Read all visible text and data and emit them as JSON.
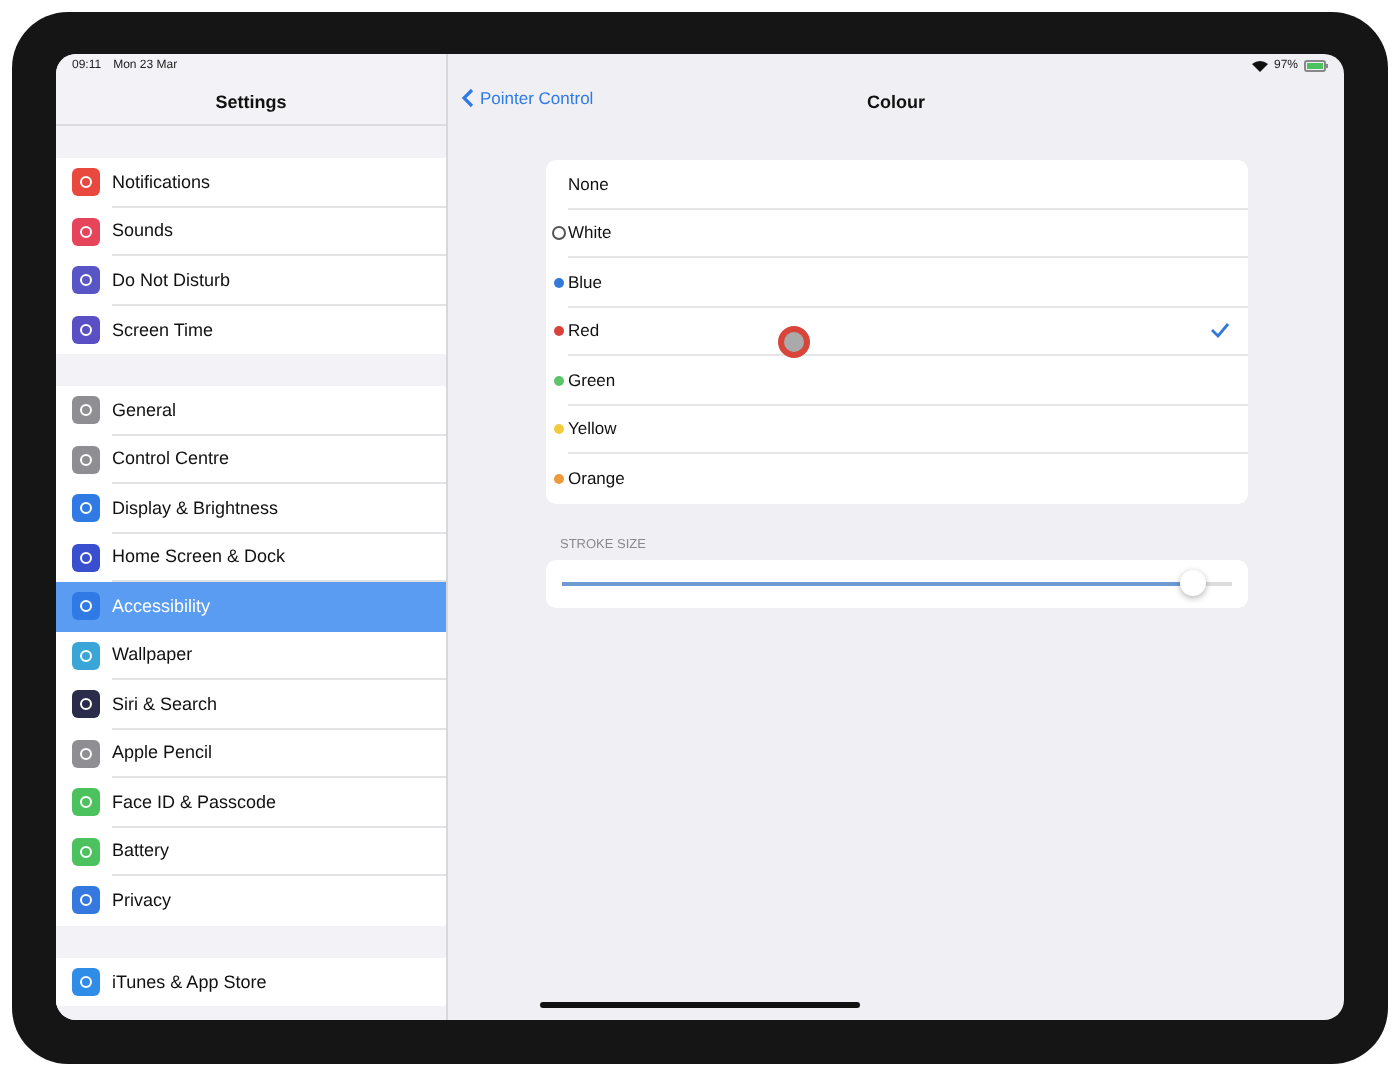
{
  "status_bar": {
    "time": "09:11",
    "date": "Mon 23 Mar",
    "battery": "97%"
  },
  "sidebar": {
    "title": "Settings",
    "groups": [
      [
        {
          "label": "Notifications",
          "color": "#e8483d",
          "selected": false
        },
        {
          "label": "Sounds",
          "color": "#e6445a",
          "selected": false
        },
        {
          "label": "Do Not Disturb",
          "color": "#5856c6",
          "selected": false
        },
        {
          "label": "Screen Time",
          "color": "#5a4fc4",
          "selected": false
        }
      ],
      [
        {
          "label": "General",
          "color": "#8e8e93",
          "selected": false
        },
        {
          "label": "Control Centre",
          "color": "#8e8e93",
          "selected": false
        },
        {
          "label": "Display & Brightness",
          "color": "#2f7ae5",
          "selected": false
        },
        {
          "label": "Home Screen & Dock",
          "color": "#3a4fcf",
          "selected": false
        },
        {
          "label": "Accessibility",
          "color": "#2f7ae5",
          "selected": true
        },
        {
          "label": "Wallpaper",
          "color": "#3aa6d8",
          "selected": false
        },
        {
          "label": "Siri & Search",
          "color": "#2b2b4a",
          "selected": false
        },
        {
          "label": "Apple Pencil",
          "color": "#8e8e93",
          "selected": false
        },
        {
          "label": "Face ID & Passcode",
          "color": "#4cc25f",
          "selected": false
        },
        {
          "label": "Battery",
          "color": "#4cc25f",
          "selected": false
        },
        {
          "label": "Privacy",
          "color": "#3478e0",
          "selected": false
        }
      ],
      [
        {
          "label": "iTunes & App Store",
          "color": "#2f8de8",
          "selected": false
        }
      ]
    ]
  },
  "detail": {
    "back": "Pointer Control",
    "title": "Colour",
    "colours": [
      {
        "label": "None",
        "selected": false
      },
      {
        "label": "White",
        "color": "#ffffff",
        "selected": false
      },
      {
        "label": "Blue",
        "color": "#3478d8",
        "selected": false
      },
      {
        "label": "Red",
        "color": "#d9423a",
        "selected": true
      },
      {
        "label": "Green",
        "color": "#5cc46a",
        "selected": false
      },
      {
        "label": "Yellow",
        "color": "#f2cc3c",
        "selected": false
      },
      {
        "label": "Orange",
        "color": "#ee9a3a",
        "selected": false
      }
    ],
    "stroke_label": "STROKE SIZE",
    "stroke": {
      "level": 0.94
    }
  }
}
